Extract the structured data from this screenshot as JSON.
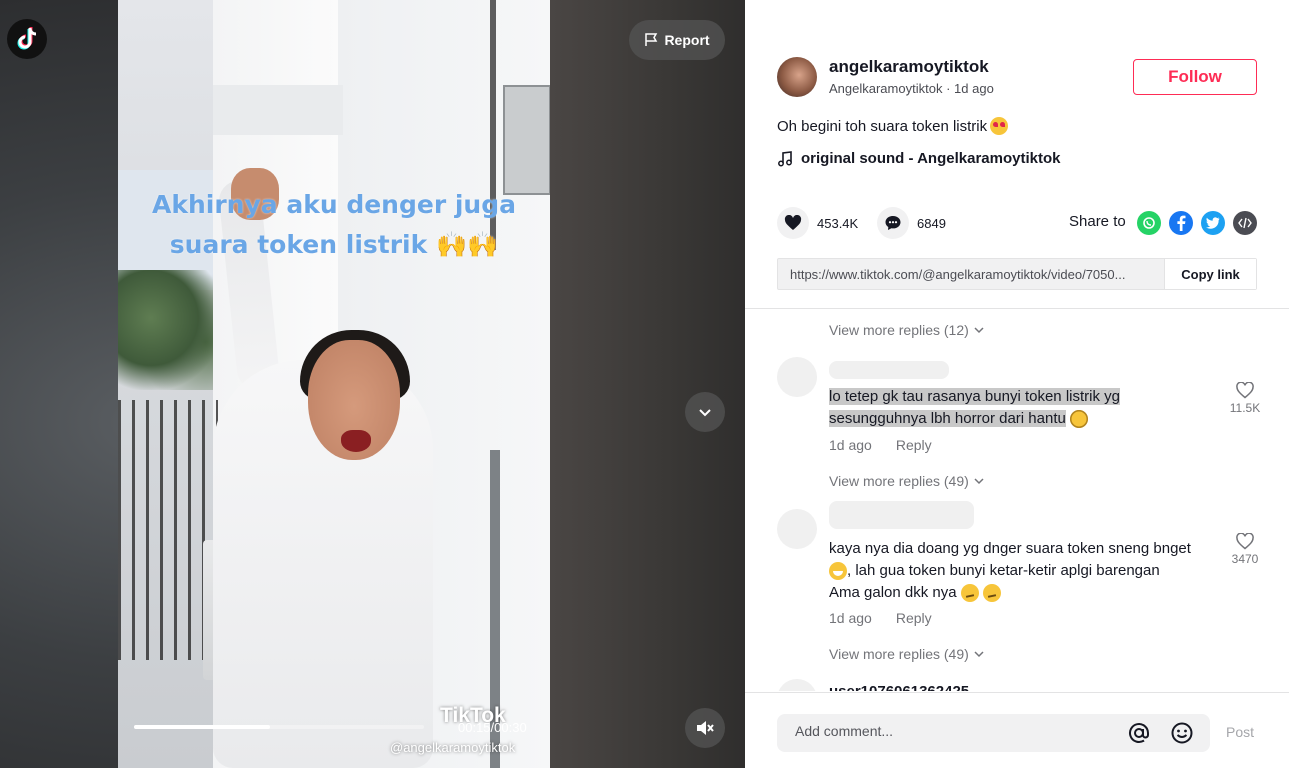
{
  "video": {
    "caption_line1": "Akhirnya aku denger juga",
    "caption_line2": "suara token listrik 🙌🙌",
    "progress_fraction": 0.47,
    "time": "00:15/00:30",
    "watermark_logo": "TikTok",
    "watermark_user": "@angelkaramoytiktok",
    "report_label": "Report"
  },
  "post": {
    "username": "angelkaramoytiktok",
    "display_name": "Angelkaramoytiktok",
    "time_ago": "1d ago",
    "follow_label": "Follow",
    "description": "Oh begini toh suara token listrik",
    "sound": "original sound - Angelkaramoytiktok",
    "likes": "453.4K",
    "comments": "6849",
    "share_label": "Share to",
    "share_targets": [
      "whatsapp-icon",
      "facebook-icon",
      "twitter-icon",
      "embed-icon"
    ],
    "link": "https://www.tiktok.com/@angelkaramoytiktok/video/7050...",
    "copy_label": "Copy link"
  },
  "comments": {
    "more_replies_1": "View more replies (12)",
    "c1_text_line1": "lo tetep gk tau rasanya bunyi token listrik yg",
    "c1_text_line2": "sesungguhnya lbh horror dari hantu",
    "c1_time": "1d ago",
    "c1_reply": "Reply",
    "c1_likes": "11.5K",
    "more_replies_2": "View more replies (49)",
    "c2_text_line1": "kaya nya dia doang yg dnger suara token sneng bnget",
    "c2_text_line2": ", lah gua token bunyi ketar-ketir aplgi barengan",
    "c2_text_line3": "Ama galon dkk nya",
    "c2_time": "1d ago",
    "c2_reply": "Reply",
    "c2_likes": "3470",
    "more_replies_3": "View more replies (49)",
    "next_user": "user1076061362425"
  },
  "composer": {
    "placeholder": "Add comment...",
    "post_label": "Post"
  },
  "colors": {
    "accent": "#fe2c55",
    "whatsapp": "#25d366",
    "facebook": "#1877f2",
    "twitter": "#1da1f2",
    "embed": "#4b4c53"
  }
}
